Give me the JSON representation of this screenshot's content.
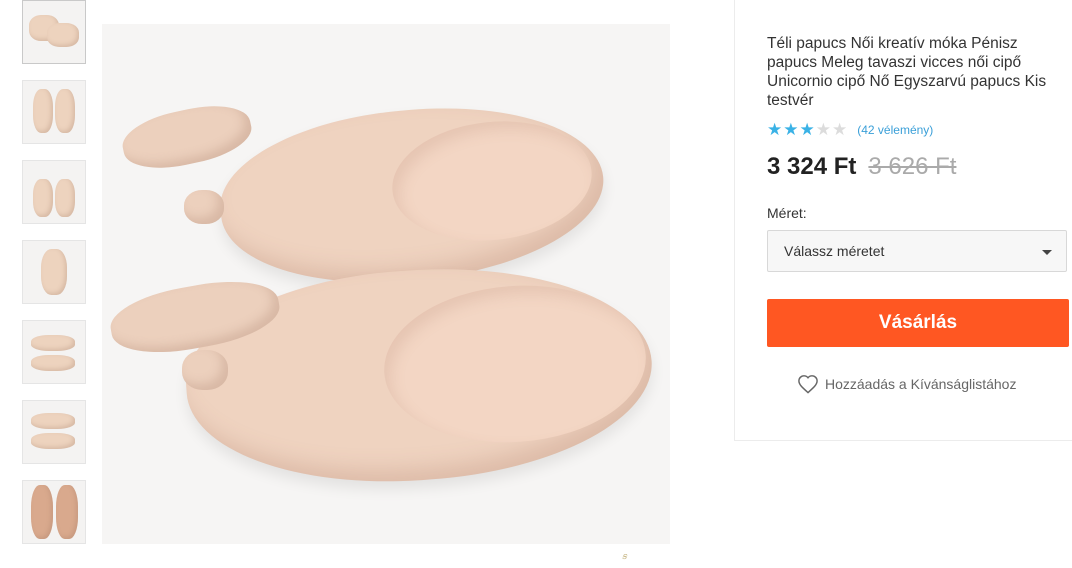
{
  "product": {
    "title": "Téli papucs Női kreatív móka Pénisz papucs Meleg tavaszi vicces női cipő Unicornio cipő Nő Egyszarvú papucs Kis testvér",
    "rating": {
      "value": 3,
      "max": 5,
      "reviews_label": "(42 vélemény)"
    },
    "price": "3 324 Ft",
    "old_price": "3 626 Ft"
  },
  "size": {
    "label": "Méret:",
    "placeholder": "Válassz méretet"
  },
  "actions": {
    "buy_label": "Vásárlás",
    "wishlist_label": "Hozzáadás a Kívánságlistához"
  },
  "colors": {
    "accent": "#ff5722",
    "star_on": "#3ab2e6",
    "star_off": "#dcdcdc",
    "link": "#3a9fd8"
  },
  "icons": {
    "wishlist": "heart-outline-icon",
    "dropdown": "caret-down-icon",
    "star": "star-icon"
  }
}
